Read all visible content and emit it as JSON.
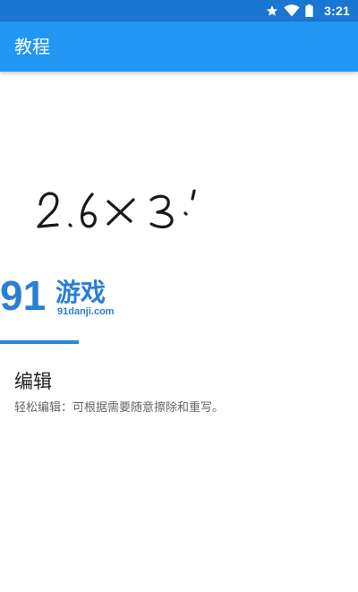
{
  "status_bar": {
    "time": "3:21",
    "icons": [
      "star-icon",
      "wifi-icon",
      "battery-icon"
    ]
  },
  "app_bar": {
    "title": "教程"
  },
  "tutorial": {
    "illustration": "handwritten-expression",
    "handwriting_text": "2.6×3.'",
    "watermark": {
      "number_mark": "91",
      "text": "游戏",
      "url": "91danji.com"
    },
    "feature_title": "编辑",
    "feature_description": "轻松编辑：可根据需要随意擦除和重写。"
  },
  "colors": {
    "status_bar": "#1976d2",
    "app_bar": "#2196f3",
    "indicator": "#2688d8",
    "ink": "#1a1a1a"
  }
}
